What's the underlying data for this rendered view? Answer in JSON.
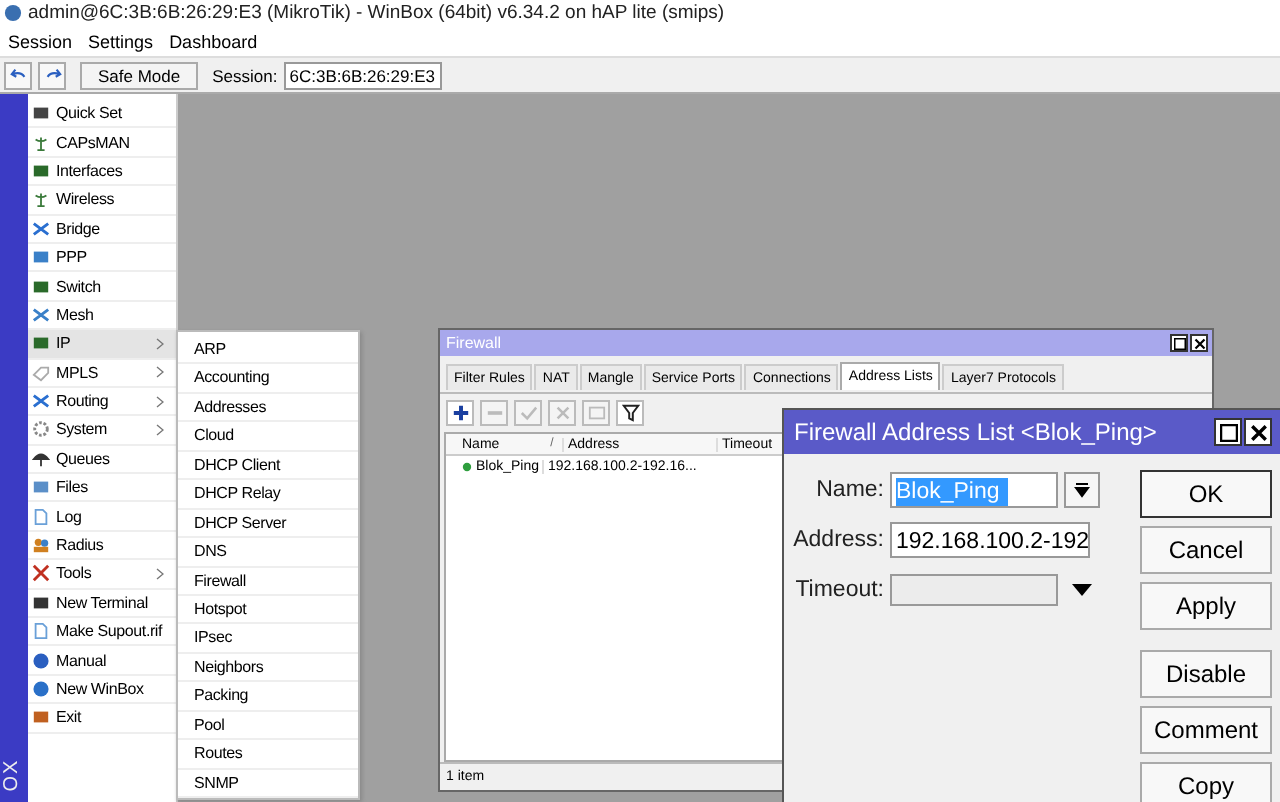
{
  "window": {
    "title": "admin@6C:3B:6B:26:29:E3 (MikroTik) - WinBox (64bit) v6.34.2 on hAP lite (smips)"
  },
  "menu_bar": [
    "Session",
    "Settings",
    "Dashboard"
  ],
  "toolbar": {
    "safe_mode": "Safe Mode",
    "session_label": "Session:",
    "session_value": "6C:3B:6B:26:29:E3"
  },
  "sidebar": {
    "brand": "OX",
    "items": [
      {
        "label": "Quick Set",
        "submenu": false,
        "selected": false
      },
      {
        "label": "CAPsMAN",
        "submenu": false,
        "selected": false
      },
      {
        "label": "Interfaces",
        "submenu": false,
        "selected": false
      },
      {
        "label": "Wireless",
        "submenu": false,
        "selected": false
      },
      {
        "label": "Bridge",
        "submenu": false,
        "selected": false
      },
      {
        "label": "PPP",
        "submenu": false,
        "selected": false
      },
      {
        "label": "Switch",
        "submenu": false,
        "selected": false
      },
      {
        "label": "Mesh",
        "submenu": false,
        "selected": false
      },
      {
        "label": "IP",
        "submenu": true,
        "selected": true
      },
      {
        "label": "MPLS",
        "submenu": true,
        "selected": false
      },
      {
        "label": "Routing",
        "submenu": true,
        "selected": false
      },
      {
        "label": "System",
        "submenu": true,
        "selected": false
      },
      {
        "label": "Queues",
        "submenu": false,
        "selected": false
      },
      {
        "label": "Files",
        "submenu": false,
        "selected": false
      },
      {
        "label": "Log",
        "submenu": false,
        "selected": false
      },
      {
        "label": "Radius",
        "submenu": false,
        "selected": false
      },
      {
        "label": "Tools",
        "submenu": true,
        "selected": false
      },
      {
        "label": "New Terminal",
        "submenu": false,
        "selected": false
      },
      {
        "label": "Make Supout.rif",
        "submenu": false,
        "selected": false
      },
      {
        "label": "Manual",
        "submenu": false,
        "selected": false
      },
      {
        "label": "New WinBox",
        "submenu": false,
        "selected": false
      },
      {
        "label": "Exit",
        "submenu": false,
        "selected": false
      }
    ]
  },
  "submenu": [
    "ARP",
    "Accounting",
    "Addresses",
    "Cloud",
    "DHCP Client",
    "DHCP Relay",
    "DHCP Server",
    "DNS",
    "Firewall",
    "Hotspot",
    "IPsec",
    "Neighbors",
    "Packing",
    "Pool",
    "Routes",
    "SNMP"
  ],
  "firewall_window": {
    "title": "Firewall",
    "tabs": [
      {
        "label": "Filter Rules",
        "selected": false
      },
      {
        "label": "NAT",
        "selected": false
      },
      {
        "label": "Mangle",
        "selected": false
      },
      {
        "label": "Service Ports",
        "selected": false
      },
      {
        "label": "Connections",
        "selected": false
      },
      {
        "label": "Address Lists",
        "selected": true
      },
      {
        "label": "Layer7 Protocols",
        "selected": false
      }
    ],
    "tools": [
      {
        "kind": "add",
        "disabled": false
      },
      {
        "kind": "remove",
        "disabled": true
      },
      {
        "kind": "enable",
        "disabled": true
      },
      {
        "kind": "disable",
        "disabled": true
      },
      {
        "kind": "comment",
        "disabled": true
      },
      {
        "kind": "filter",
        "disabled": false
      }
    ],
    "columns": [
      "Name",
      "Address",
      "Timeout"
    ],
    "sort_mark": "/",
    "rows": [
      {
        "name": "Blok_Ping",
        "address": "192.168.100.2-192.16...",
        "color": "#2e9e3e"
      }
    ],
    "status": "1 item"
  },
  "address_list_dialog": {
    "title": "Firewall Address List <Blok_Ping>",
    "fields": [
      {
        "label": "Name:",
        "value": "Blok_Ping",
        "highlighted": true,
        "kind": "combo"
      },
      {
        "label": "Address:",
        "value": "192.168.100.2-192",
        "kind": "text"
      },
      {
        "label": "Timeout:",
        "kind": "dropdown"
      }
    ],
    "buttons": [
      {
        "label": "OK",
        "default": true
      },
      {
        "label": "Cancel",
        "default": false
      },
      {
        "label": "Apply",
        "default": false
      },
      {
        "label": "Disable",
        "default": false
      },
      {
        "label": "Comment",
        "default": false
      },
      {
        "label": "Copy",
        "default": false
      }
    ]
  }
}
